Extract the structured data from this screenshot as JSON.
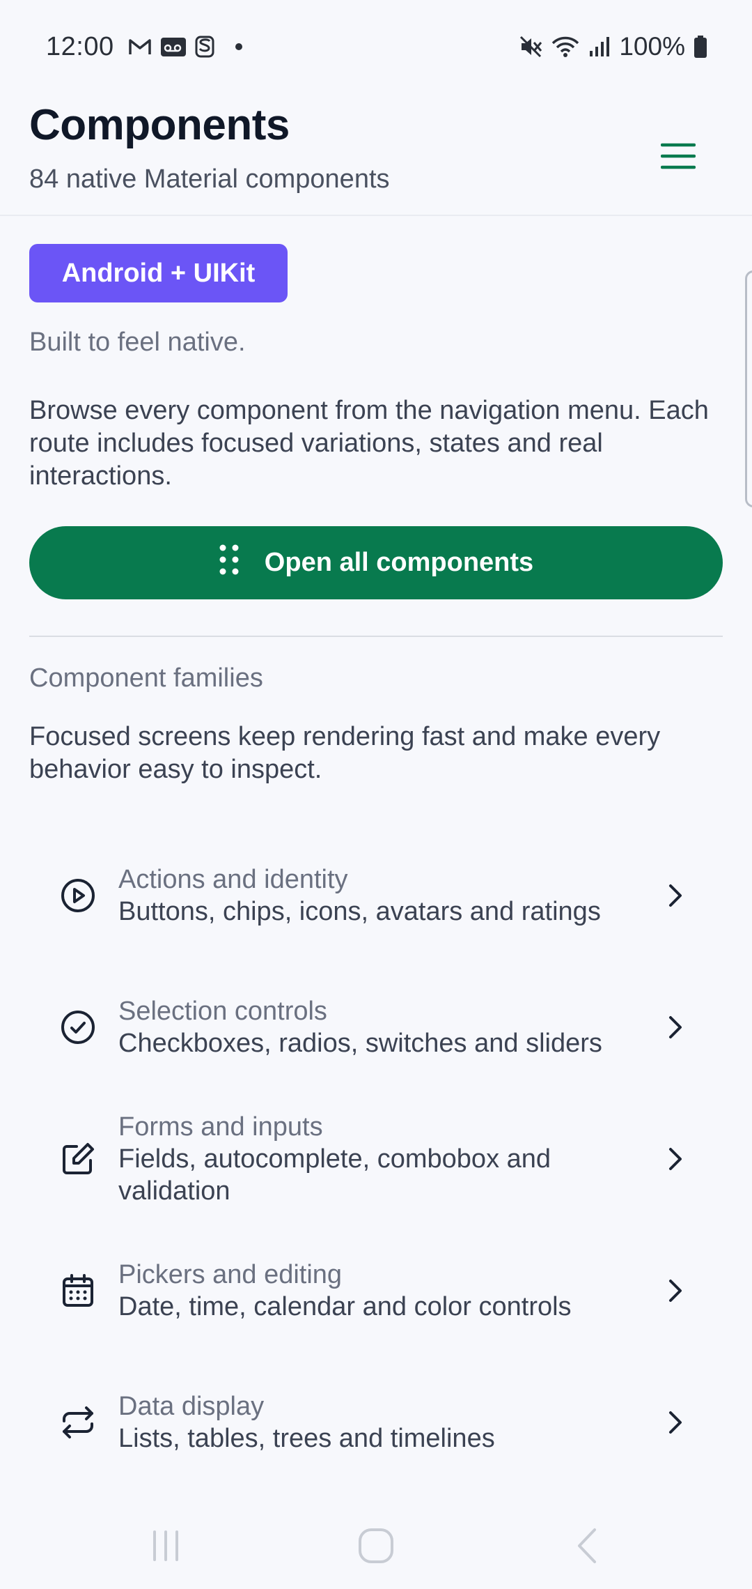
{
  "status_bar": {
    "time": "12:00",
    "battery": "100%",
    "icons": [
      "gmail-icon",
      "voicemail-icon",
      "s-icon",
      "notification-dot",
      "mute-icon",
      "wifi-icon",
      "signal-icon",
      "battery-icon"
    ]
  },
  "header": {
    "title": "Components",
    "subtitle": "84 native Material components",
    "menu_icon": "menu-icon"
  },
  "colors": {
    "accent_green": "#087A4E",
    "badge_purple": "#6B55F6",
    "background": "#F7F8FC"
  },
  "badge": {
    "label": "Android + UIKit"
  },
  "tagline": "Built to feel native.",
  "intro": "Browse every component from the navigation menu. Each route includes focused variations, states and real interactions.",
  "primary_button": {
    "label": "Open all components",
    "icon": "grid-dots-icon"
  },
  "families_section": {
    "title": "Component families",
    "description": "Focused screens keep rendering fast and make every behavior easy to inspect.",
    "items": [
      {
        "title": "Actions and identity",
        "description": "Buttons, chips, icons, avatars and ratings",
        "icon": "play-circle-icon"
      },
      {
        "title": "Selection controls",
        "description": "Checkboxes, radios, switches and sliders",
        "icon": "check-circle-icon"
      },
      {
        "title": "Forms and inputs",
        "description": "Fields, autocomplete, combobox and validation",
        "icon": "edit-icon"
      },
      {
        "title": "Pickers and editing",
        "description": "Date, time, calendar and color controls",
        "icon": "calendar-icon"
      },
      {
        "title": "Data display",
        "description": "Lists, tables, trees and timelines",
        "icon": "repeat-icon"
      }
    ]
  },
  "nav_bar": {
    "buttons": [
      "recents-icon",
      "home-icon",
      "back-icon"
    ]
  }
}
